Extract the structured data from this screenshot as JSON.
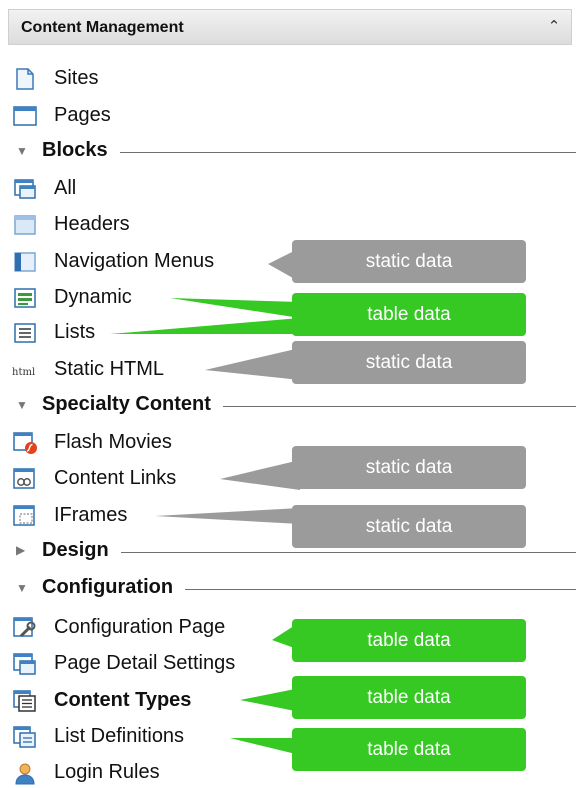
{
  "panel": {
    "title": "Content Management",
    "collapse_icon": "double-chevron-up-icon"
  },
  "items": {
    "sites": "Sites",
    "pages": "Pages",
    "all": "All",
    "headers": "Headers",
    "navigation_menus": "Navigation Menus",
    "dynamic": "Dynamic",
    "lists": "Lists",
    "static_html": "Static HTML",
    "flash_movies": "Flash Movies",
    "content_links": "Content Links",
    "iframes": "IFrames",
    "configuration_page": "Configuration Page",
    "page_detail_settings": "Page Detail Settings",
    "content_types": "Content Types",
    "list_definitions": "List Definitions",
    "login_rules": "Login Rules"
  },
  "sections": {
    "blocks": "Blocks",
    "specialty_content": "Specialty Content",
    "design": "Design",
    "configuration": "Configuration"
  },
  "callouts": {
    "static": "static data",
    "table": "table data"
  },
  "colors": {
    "static_callout": "#9b9b9b",
    "table_callout": "#36c823"
  }
}
